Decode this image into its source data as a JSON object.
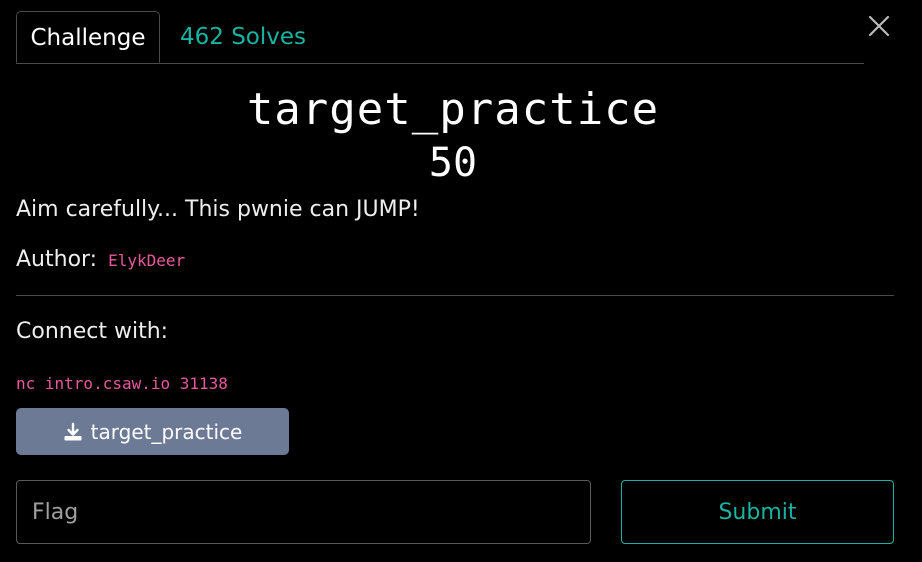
{
  "tabs": {
    "challenge_label": "Challenge",
    "solves_label": "462 Solves"
  },
  "challenge": {
    "name": "target_practice",
    "value": "50",
    "description": "Aim carefully... This pwnie can JUMP!",
    "author_label": "Author:",
    "author_name": "ElykDeer",
    "connect_label": "Connect with:",
    "connect_cmd": "nc intro.csaw.io 31138",
    "file_name": "target_practice"
  },
  "form": {
    "flag_placeholder": "Flag",
    "flag_value": "",
    "submit_label": "Submit"
  },
  "icons": {
    "close": "close-icon",
    "download": "download-icon"
  },
  "colors": {
    "background": "#000000",
    "accent_teal": "#17b3a3",
    "author_pink": "#e8589e",
    "download_button": "#6c7a96"
  }
}
